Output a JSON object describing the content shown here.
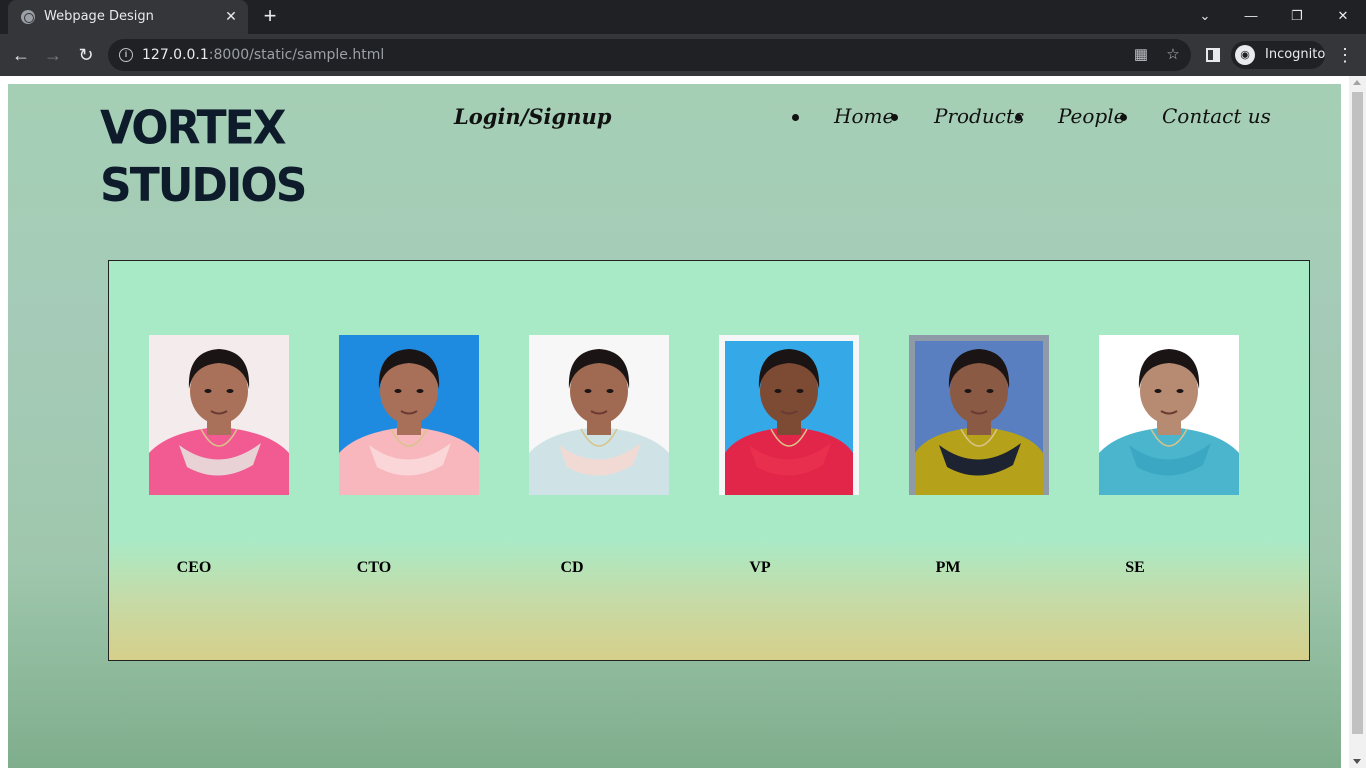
{
  "browser": {
    "tab_title": "Webpage Design",
    "url_host": "127.0.0.1",
    "url_path": ":8000/static/sample.html",
    "profile_label": "Incognito"
  },
  "site": {
    "logo_line1": "VORTEX",
    "logo_line2": "STUDIOS",
    "login_label": "Login/Signup",
    "nav": [
      "Home",
      "Products",
      "People",
      "Contact us"
    ]
  },
  "team": [
    {
      "role": "CEO",
      "bg": "#f4ecec",
      "outfit": "#f25a92",
      "shawl": "#e8d2d6",
      "skin": "#a9715a"
    },
    {
      "role": "CTO",
      "bg": "#1e8be0",
      "outfit": "#f7b7bd",
      "shawl": "#fad6d9",
      "skin": "#a87058"
    },
    {
      "role": "CD",
      "bg": "#f7f7f7",
      "outfit": "#cfe3e6",
      "shawl": "#f2dad4",
      "skin": "#a06a52"
    },
    {
      "role": "VP",
      "bg": "#35a8e8",
      "outfit": "#e2264a",
      "shawl": "#e8304e",
      "skin": "#7d4a34"
    },
    {
      "role": "PM",
      "bg": "#5a7fc0",
      "outfit": "#b5a21a",
      "shawl": "#1d2330",
      "skin": "#8a5a44"
    },
    {
      "role": "SE",
      "bg": "#ffffff",
      "outfit": "#4ab5cc",
      "shawl": "#3ba7c2",
      "skin": "#b78a72"
    }
  ]
}
